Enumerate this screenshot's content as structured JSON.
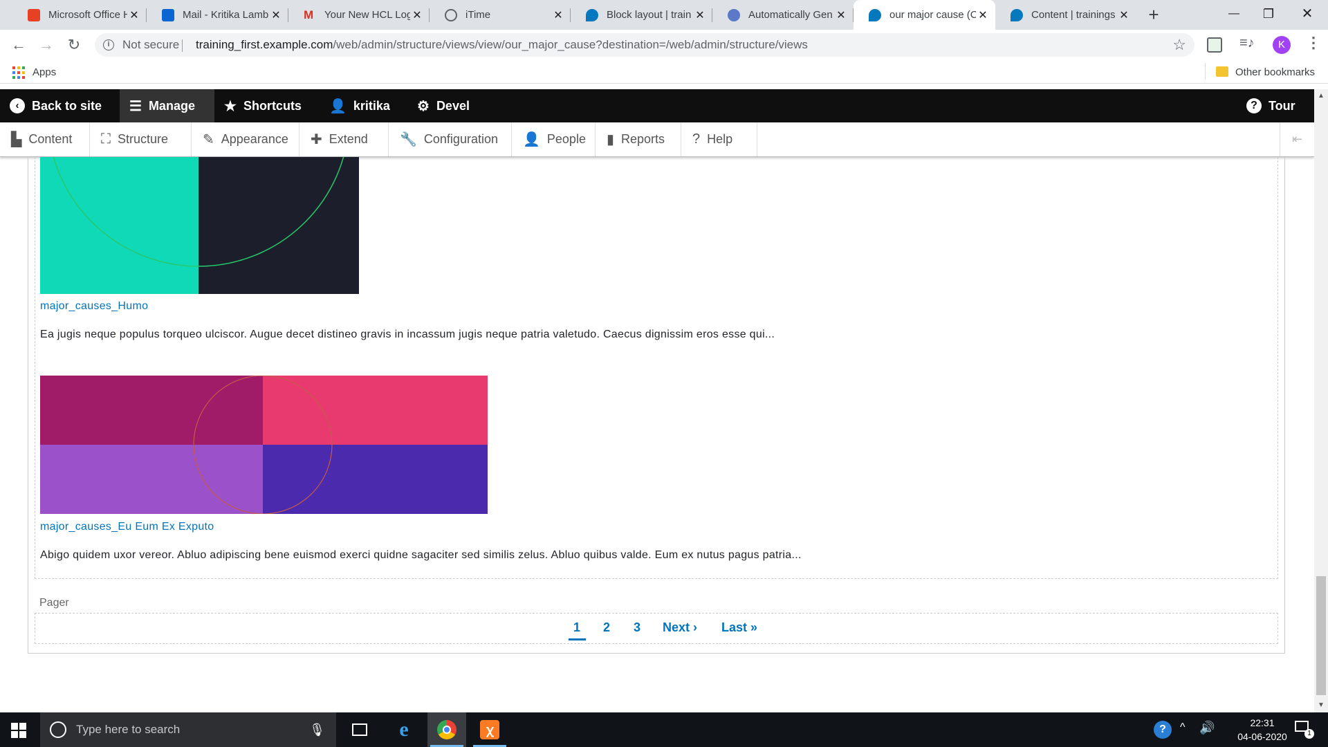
{
  "browser": {
    "tabs": [
      {
        "title": "Microsoft Office H",
        "icon": "office-icon",
        "color": "#e74025"
      },
      {
        "title": "Mail - Kritika Lamb",
        "icon": "outlook-icon",
        "color": "#0a64d2"
      },
      {
        "title": "Your New HCL Log",
        "icon": "gmail-icon",
        "color": "#d93025"
      },
      {
        "title": "iTime",
        "icon": "globe-icon",
        "color": "#5f6368"
      },
      {
        "title": "Block layout | train",
        "icon": "drupal-icon",
        "color": "#0678be"
      },
      {
        "title": "Automatically Gen",
        "icon": "gen-icon",
        "color": "#5b79c8"
      },
      {
        "title": "our major cause (C",
        "icon": "drupal-icon",
        "color": "#0678be",
        "active": true
      },
      {
        "title": "Content | trainings",
        "icon": "drupal-icon",
        "color": "#0678be"
      }
    ],
    "not_secure": "Not secure",
    "url_host": "training_first.example.com",
    "url_path": "/web/admin/structure/views/view/our_major_cause?destination=/web/admin/structure/views",
    "profile_initial": "K",
    "bookmarks": {
      "apps": "Apps",
      "other": "Other bookmarks"
    }
  },
  "admin_toolbar": {
    "back": "Back to site",
    "manage": "Manage",
    "shortcuts": "Shortcuts",
    "user": "kritika",
    "devel": "Devel",
    "tour": "Tour"
  },
  "admin_tray": {
    "items": [
      "Content",
      "Structure",
      "Appearance",
      "Extend",
      "Configuration",
      "People",
      "Reports",
      "Help"
    ]
  },
  "rows": [
    {
      "title": "major_causes_Humo",
      "body": "Ea jugis neque populus torqueo ulciscor. Augue decet distineo gravis in incassum jugis neque patria valetudo. Caecus dignissim eros esse qui..."
    },
    {
      "title": "major_causes_Eu Eum Ex Exputo",
      "body": "Abigo quidem uxor vereor. Abluo adipiscing bene euismod exerci quidne sagaciter sed similis zelus. Abluo quibus valde. Eum ex nutus pagus patria..."
    }
  ],
  "pager": {
    "label": "Pager",
    "pages": [
      "1",
      "2",
      "3"
    ],
    "next": "Next ›",
    "last": "Last »",
    "current": "1"
  },
  "taskbar": {
    "search_placeholder": "Type here to search",
    "time": "22:31",
    "date": "04-06-2020",
    "notification_count": "1"
  },
  "image_colors": {
    "teal": "#10d9b8",
    "navy": "#1c1f2b",
    "magenta": "#a01b68",
    "pink": "#e83a6f",
    "purple": "#9b51c9",
    "indigo": "#4b2aad"
  }
}
